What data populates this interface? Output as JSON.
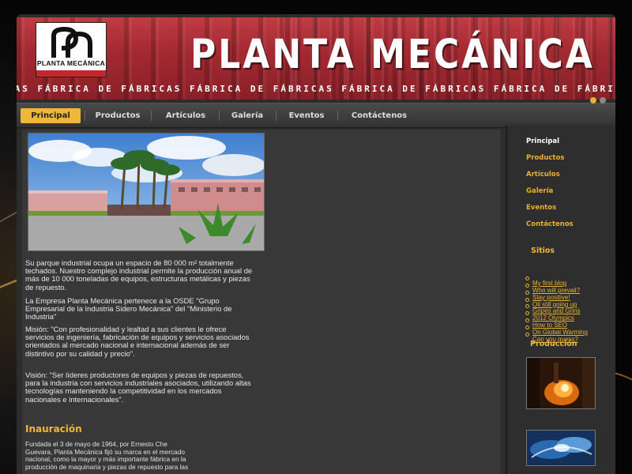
{
  "site": {
    "title": "PLANTA MECÁNICA",
    "logo_text": "PLANTA MECÁNICA",
    "ticker": "CAS   FÁBRICA DE FÁBRICAS   FÁBRICA DE FÁBRICAS   FÁBRICA DE FÁBRICAS   FÁBRICA DE FÁBRICAS   FÁBRICA DE FÁBRICAS"
  },
  "nav": {
    "items": [
      {
        "label": "Principal"
      },
      {
        "label": "Productos"
      },
      {
        "label": "Artículos"
      },
      {
        "label": "Galería"
      },
      {
        "label": "Eventos"
      },
      {
        "label": "Contáctenos"
      }
    ]
  },
  "main": {
    "paragraphs": [
      " Su  parque industrial ocupa un espacio de 80 000 m² totalmente techados. Nuestro complejo industrial permite la producción anual de más de 10 000 toneladas de equipos, estructuras metálicas y piezas de repuesto.",
      "La Empresa Planta Mecánica pertenece a la OSDE \"Grupo Empresarial de la Industria Sidero Mecánica\" del \"Ministerio de Industria\"",
      "Misión: \"Con profesionalidad y lealtad a sus clientes le ofrece servicios de ingeniería, fabricación de equipos y servicios asociados orientados al mercado nacional e internacional además de ser distintivo por su calidad y precio\".",
      "Visión: \"Ser líderes productores de equipos y piezas de repuestos, para la industria con servicios industriales asociados, utilizando altas tecnologías manteniendo la competitividad en los mercados nacionales e internacionales\"."
    ],
    "section_heading": "Inauración",
    "section_text": "Fundada el 3 de mayo de 1964, por Ernesto Che Guevara, Planta Mecánica fijó su marca en el mercado nacional, como la mayor y más importante fábrica en la producción de maquinaria y piezas de repuesto para las"
  },
  "sidebar": {
    "links": [
      {
        "label": "Principal"
      },
      {
        "label": "Productos"
      },
      {
        "label": "Artículos"
      },
      {
        "label": "Galería"
      },
      {
        "label": "Eventos"
      },
      {
        "label": "Contáctenos"
      }
    ],
    "sites_heading": "Sitios",
    "sites": [
      {
        "label": "My first blog"
      },
      {
        "label": "Who will prevail?"
      },
      {
        "label": "Stay positive!"
      },
      {
        "label": "Oil still going up"
      },
      {
        "label": "Gripes and Grins"
      },
      {
        "label": "2012 Olympics"
      },
      {
        "label": "How to SEO"
      },
      {
        "label": "On Global Warming"
      },
      {
        "label": "Can you guess?"
      }
    ],
    "production_heading": "Producción"
  },
  "colors": {
    "accent": "#f0b638",
    "banner_red": "#a52a32",
    "page_bg": "#2c2c2c"
  },
  "icons": {
    "logo": "planta-mecanica-logo-icon",
    "slider": "slider-dot-icon"
  }
}
